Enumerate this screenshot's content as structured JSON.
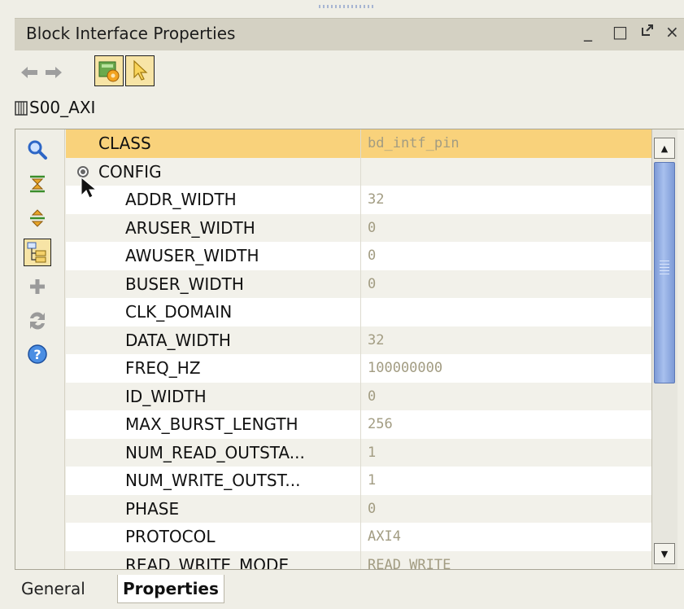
{
  "window": {
    "title": "Block Interface Properties",
    "controls": {
      "minimize": "_",
      "maximize": "□",
      "float": "⤢",
      "close": "×"
    }
  },
  "toolbar": {
    "back_icon": "back-arrow-icon",
    "forward_icon": "forward-arrow-icon",
    "tools": [
      "properties-gear-icon",
      "select-pointer-icon"
    ]
  },
  "object": {
    "name": "S00_AXI",
    "icon": "interface-pin-icon"
  },
  "sidebar": {
    "buttons": [
      "search-icon",
      "collapse-all-icon",
      "expand-all-icon",
      "hierarchy-icon",
      "add-icon",
      "refresh-icon",
      "help-icon"
    ],
    "selected": "hierarchy-icon"
  },
  "properties": [
    {
      "name": "CLASS",
      "value": "bd_intf_pin",
      "indent": 0,
      "selected": true
    },
    {
      "name": "CONFIG",
      "value": "",
      "indent": 0,
      "group": true
    },
    {
      "name": "ADDR_WIDTH",
      "value": "32",
      "indent": 1
    },
    {
      "name": "ARUSER_WIDTH",
      "value": "0",
      "indent": 1
    },
    {
      "name": "AWUSER_WIDTH",
      "value": "0",
      "indent": 1
    },
    {
      "name": "BUSER_WIDTH",
      "value": "0",
      "indent": 1
    },
    {
      "name": "CLK_DOMAIN",
      "value": "",
      "indent": 1
    },
    {
      "name": "DATA_WIDTH",
      "value": "32",
      "indent": 1
    },
    {
      "name": "FREQ_HZ",
      "value": "100000000",
      "indent": 1
    },
    {
      "name": "ID_WIDTH",
      "value": "0",
      "indent": 1
    },
    {
      "name": "MAX_BURST_LENGTH",
      "value": "256",
      "indent": 1
    },
    {
      "name": "NUM_READ_OUTSTA...",
      "value": "1",
      "indent": 1
    },
    {
      "name": "NUM_WRITE_OUTST...",
      "value": "1",
      "indent": 1
    },
    {
      "name": "PHASE",
      "value": "0",
      "indent": 1
    },
    {
      "name": "PROTOCOL",
      "value": "AXI4",
      "indent": 1
    },
    {
      "name": "READ_WRITE_MODE",
      "value": "READ_WRITE",
      "indent": 1
    }
  ],
  "tabs": [
    {
      "label": "General",
      "active": false
    },
    {
      "label": "Properties",
      "active": true
    }
  ],
  "colors": {
    "selected_row": "#f9d27b",
    "value_text": "#a29c82",
    "toolbar_button_selected": "#f7e4a6",
    "scroll_thumb": "#8aa6e0"
  }
}
